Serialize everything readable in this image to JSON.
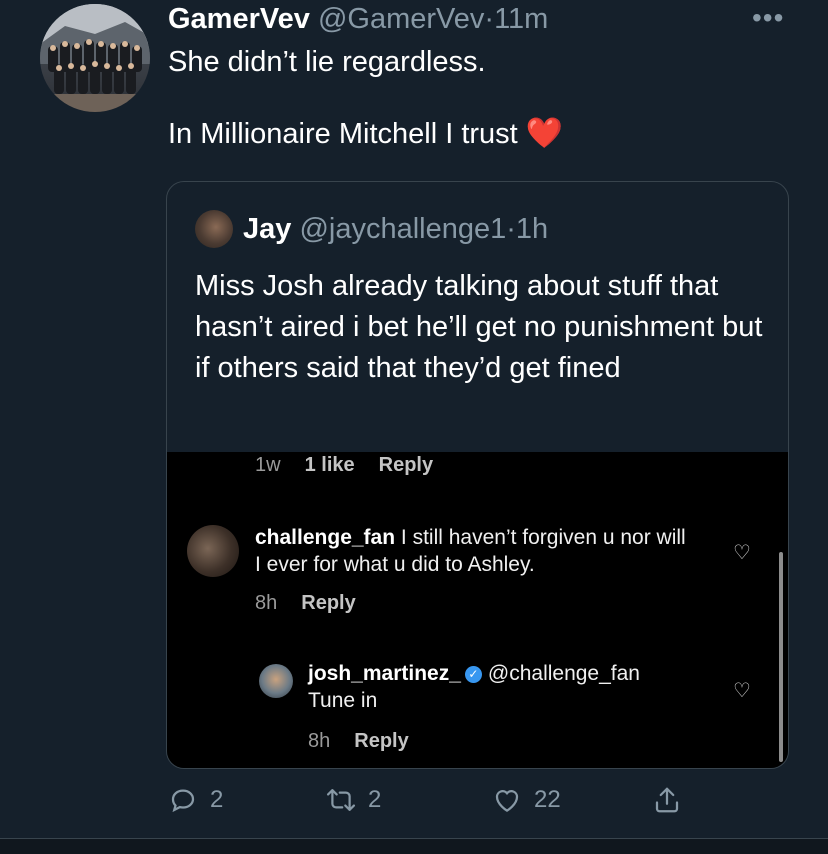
{
  "tweet": {
    "display_name": "GamerVev",
    "handle": "@GamerVev",
    "sep": "·",
    "time": "11m",
    "more_label": "•••",
    "text_line1": "She didn’t lie regardless.",
    "text_line2": "In Millionaire Mitchell I trust",
    "emoji": "❤️"
  },
  "quoted": {
    "display_name": "Jay",
    "handle": "@jaychallenge1",
    "sep": "·",
    "time": "1h",
    "text": "Miss Josh already talking about stuff that hasn’t aired i bet he’ll get no punishment but if others said that they’d get fined"
  },
  "instagram": {
    "top_meta": {
      "time": "1w",
      "likes": "1 like",
      "reply": "Reply"
    },
    "comments": [
      {
        "user": "challenge_fan",
        "text": "I still haven’t forgiven u nor will I ever for what u did to Ashley.",
        "time": "8h",
        "reply": "Reply"
      },
      {
        "user": "josh_martinez_",
        "mention": "@challenge_fan",
        "text": "Tune in",
        "time": "8h",
        "reply": "Reply"
      }
    ]
  },
  "actions": {
    "reply_count": "2",
    "retweet_count": "2",
    "like_count": "22"
  },
  "colors": {
    "background": "#15202b",
    "muted": "#8899a6",
    "border": "#38444d",
    "heart": "#e0245e",
    "verified": "#3897f0"
  }
}
